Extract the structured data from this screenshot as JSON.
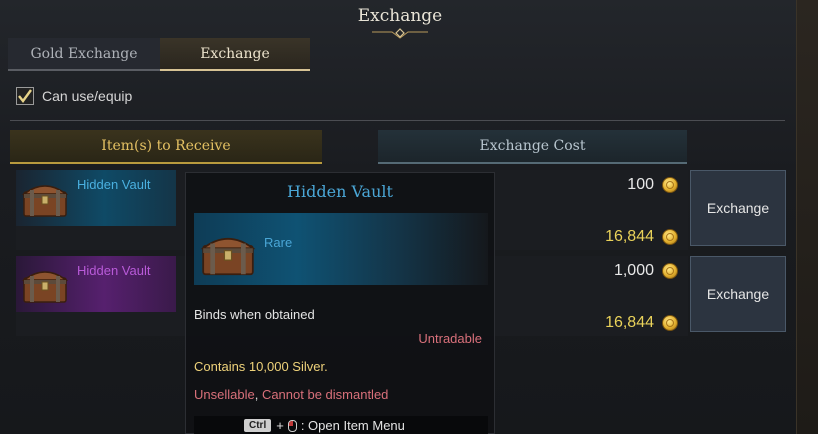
{
  "window": {
    "title": "Exchange"
  },
  "tabs": [
    {
      "label": "Gold Exchange",
      "active": false
    },
    {
      "label": "Exchange",
      "active": true
    }
  ],
  "filter": {
    "label": "Can use/equip",
    "checked": true
  },
  "columns": {
    "receive": "Item(s) to Receive",
    "cost": "Exchange Cost"
  },
  "rows": [
    {
      "item_name": "Hidden Vault",
      "grade_color": "#4ab0e0",
      "price": "100",
      "owned": "16,844",
      "button": "Exchange",
      "currency_icon": "gold-coin-icon"
    },
    {
      "item_name": "Hidden Vault",
      "grade_color": "#b85ad8",
      "price": "1,000",
      "owned": "16,844",
      "button": "Exchange",
      "currency_icon": "gold-coin-icon"
    }
  ],
  "tooltip": {
    "title": "Hidden Vault",
    "grade": "Rare",
    "bind": "Binds when obtained",
    "tradable": "Untradable",
    "contains": "Contains 10,000 Silver.",
    "restriction_1": "Unsellable",
    "separator": ", ",
    "restriction_2": "Cannot be dismantled",
    "footer_key": "Ctrl",
    "footer_plus": "+",
    "footer_text": ": Open Item Menu"
  },
  "colors": {
    "rare": "#4ab0e0",
    "epic": "#b85ad8",
    "gold_text": "#e9d25a",
    "warning": "#d8707a",
    "header_gold": "#e4c163"
  }
}
